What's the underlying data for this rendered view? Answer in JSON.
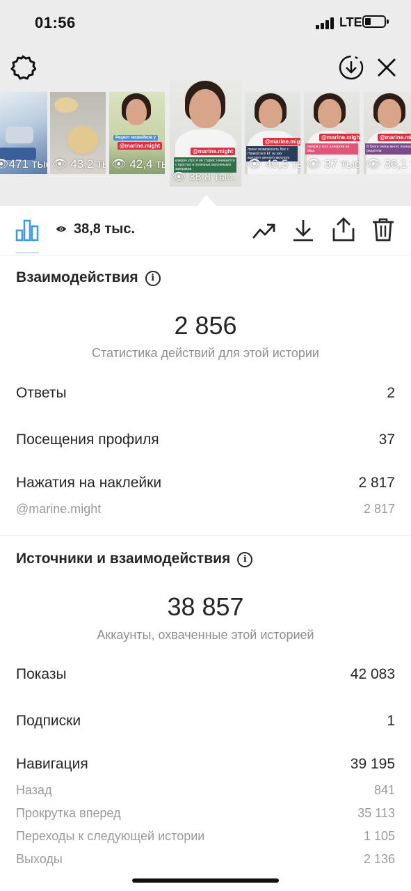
{
  "status_bar": {
    "time": "01:56",
    "network": "LTE"
  },
  "header": {
    "settings_icon": "gear-icon",
    "download_icon": "download-circle-icon",
    "close_icon": "close-icon"
  },
  "thumbnails": [
    {
      "views": "471 тыс",
      "tag": ""
    },
    {
      "views": "43,2 тыс",
      "tag": ""
    },
    {
      "views": "42,4 тыс",
      "tag": "@marine.might"
    },
    {
      "views": "38,8 тыс.",
      "tag": "@marine.might",
      "active": true
    },
    {
      "views": "40,5 тыс",
      "tag": "@marine.might"
    },
    {
      "views": "37 тыс",
      "tag": "@marine.might"
    },
    {
      "views": "36,1 тыс",
      "tag": "@marine.might"
    }
  ],
  "toolbar": {
    "views": "38,8 тыс.",
    "icons": [
      "bar-chart-icon",
      "eye-icon",
      "trend-icon",
      "download-icon",
      "share-icon",
      "trash-icon"
    ]
  },
  "interactions": {
    "title": "Взаимодействия",
    "total": "2 856",
    "subtitle": "Статистика действий для этой истории",
    "rows": [
      {
        "label": "Ответы",
        "value": "2"
      },
      {
        "label": "Посещения профиля",
        "value": "37"
      },
      {
        "label": "Нажатия на наклейки",
        "value": "2 817"
      },
      {
        "label": "@marine.might",
        "value": "2 817"
      }
    ]
  },
  "discovery": {
    "title": "Источники и взаимодействия",
    "total": "38 857",
    "subtitle": "Аккаунты, охваченные этой историей",
    "rows": [
      {
        "label": "Показы",
        "value": "42 083"
      },
      {
        "label": "Подписки",
        "value": "1"
      },
      {
        "label": "Навигация",
        "value": "39 195"
      },
      {
        "label": "Назад",
        "value": "841"
      },
      {
        "label": "Прокрутка вперед",
        "value": "35 113"
      },
      {
        "label": "Переходы к следующей истории",
        "value": "1 105"
      },
      {
        "label": "Выходы",
        "value": "2 136"
      }
    ]
  }
}
